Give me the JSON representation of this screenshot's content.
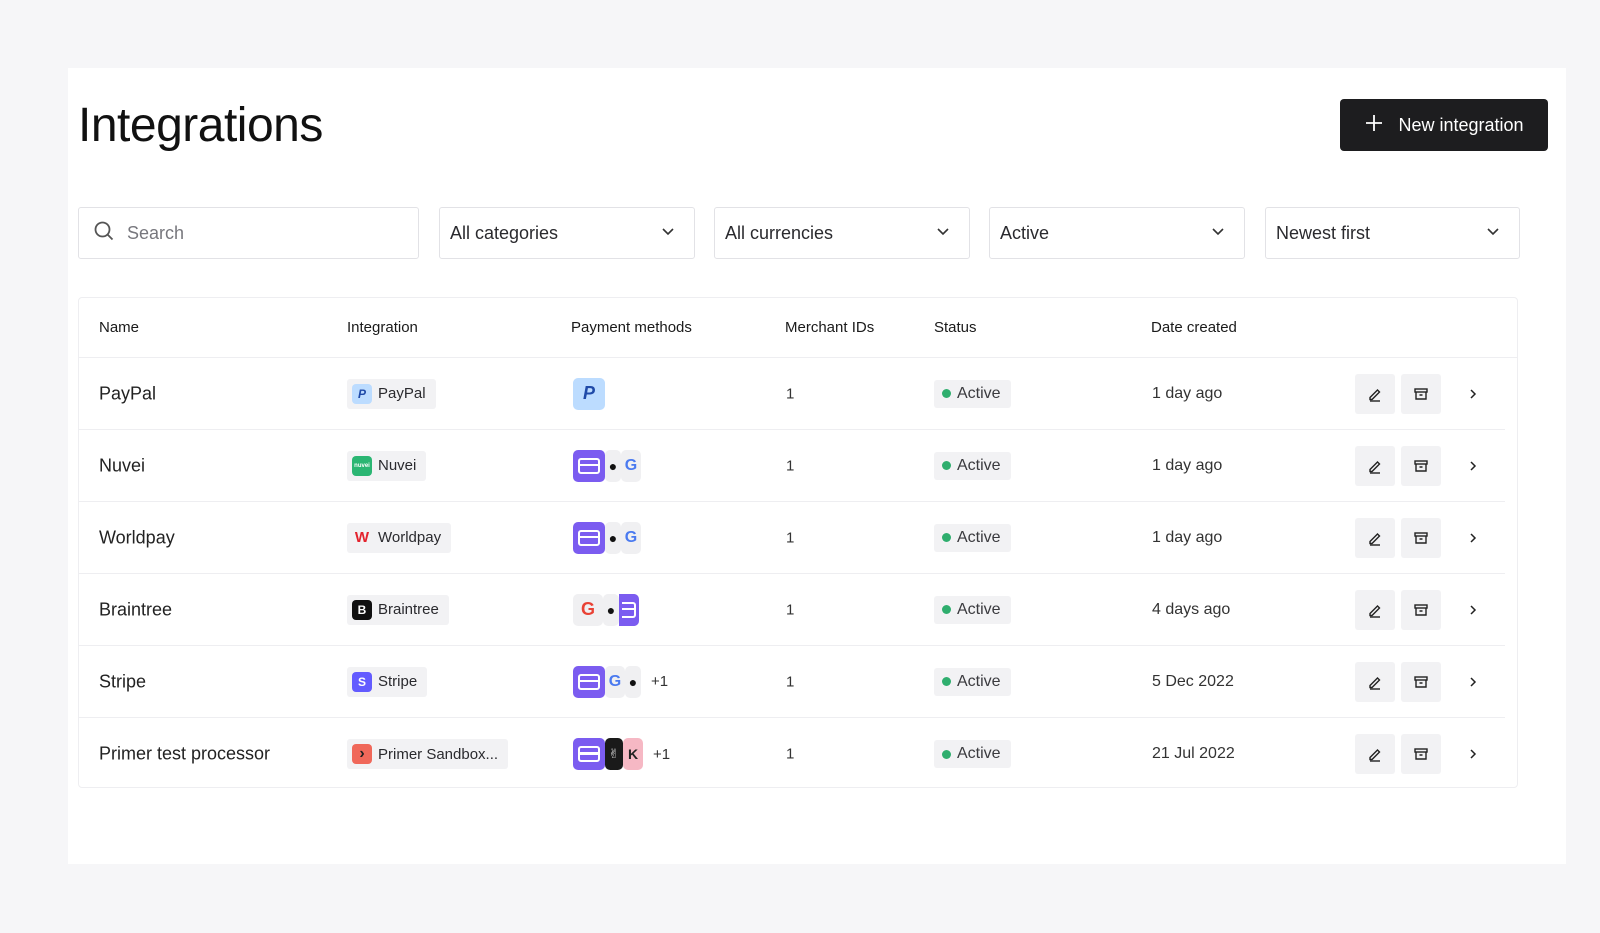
{
  "page": {
    "title": "Integrations",
    "new_button_label": "New integration"
  },
  "filters": {
    "search_placeholder": "Search",
    "category": "All categories",
    "currency": "All currencies",
    "status": "Active",
    "sort": "Newest first"
  },
  "table": {
    "headers": {
      "name": "Name",
      "integration": "Integration",
      "payment_methods": "Payment methods",
      "merchant_ids": "Merchant IDs",
      "status": "Status",
      "date_created": "Date created"
    },
    "rows": [
      {
        "name": "PayPal",
        "integration": {
          "label": "PayPal",
          "logo": "paypal-logo-icon",
          "logo_text": "P",
          "logo_color": "#bcdcff"
        },
        "payment_methods": [
          "paypal-icon"
        ],
        "more": "",
        "merchant_ids": "1",
        "status": "Active",
        "date": "1 day ago"
      },
      {
        "name": "Nuvei",
        "integration": {
          "label": "Nuvei",
          "logo": "nuvei-logo-icon",
          "logo_text": "nuvei",
          "logo_color": "#2bb673"
        },
        "payment_methods": [
          "card-icon",
          "apple-pay-icon",
          "google-pay-icon"
        ],
        "more": "",
        "merchant_ids": "1",
        "status": "Active",
        "date": "1 day ago"
      },
      {
        "name": "Worldpay",
        "integration": {
          "label": "Worldpay",
          "logo": "worldpay-logo-icon",
          "logo_text": "W",
          "logo_color": "#e3232d"
        },
        "payment_methods": [
          "card-icon",
          "apple-pay-icon",
          "google-pay-icon"
        ],
        "more": "",
        "merchant_ids": "1",
        "status": "Active",
        "date": "1 day ago"
      },
      {
        "name": "Braintree",
        "integration": {
          "label": "Braintree",
          "logo": "braintree-logo-icon",
          "logo_text": "B",
          "logo_color": "#111111"
        },
        "payment_methods": [
          "google-pay-icon",
          "apple-pay-icon",
          "card-icon"
        ],
        "more": "",
        "merchant_ids": "1",
        "status": "Active",
        "date": "4 days ago"
      },
      {
        "name": "Stripe",
        "integration": {
          "label": "Stripe",
          "logo": "stripe-logo-icon",
          "logo_text": "S",
          "logo_color": "#635bff"
        },
        "payment_methods": [
          "card-icon",
          "google-pay-icon",
          "apple-pay-icon"
        ],
        "more": "+1",
        "merchant_ids": "1",
        "status": "Active",
        "date": "5 Dec 2022"
      },
      {
        "name": "Primer test processor",
        "integration": {
          "label": "Primer Sandbox...",
          "logo": "primer-logo-icon",
          "logo_text": "›",
          "logo_color": "#f0685a"
        },
        "payment_methods": [
          "card-icon",
          "dark-wallet-icon",
          "klarna-icon"
        ],
        "more": "+1",
        "merchant_ids": "1",
        "status": "Active",
        "date": "21 Jul 2022"
      }
    ]
  },
  "colors": {
    "status_active": "#2fae6e",
    "button_dark": "#1d1d1f",
    "card_purple": "#7b5cf0"
  }
}
